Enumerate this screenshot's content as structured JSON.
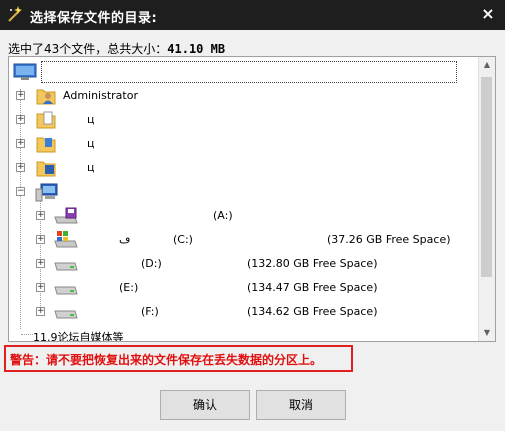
{
  "titlebar": {
    "title": "选择保存文件的目录:",
    "close": "×"
  },
  "summary": {
    "prefix": "选中了43个文件，总共大小：",
    "size": "41.10 MB"
  },
  "tree": {
    "root_label": "",
    "items": [
      {
        "label": "Administrator",
        "icon": "user-folder-icon"
      },
      {
        "label": "ц",
        "icon": "documents-folder-icon"
      },
      {
        "label": "ц",
        "icon": "music-folder-icon"
      },
      {
        "label": "ц",
        "icon": "games-folder-icon"
      },
      {
        "label": "",
        "icon": "computer-icon"
      }
    ],
    "drives": [
      {
        "name": "(A:)",
        "space": "",
        "icon": "floppy-drive-icon"
      },
      {
        "name": "(C:)",
        "prefix": "ڡ",
        "space": "(37.26 GB Free Space)",
        "icon": "system-drive-icon"
      },
      {
        "name": "(D:)",
        "space": "(132.80 GB Free Space)",
        "icon": "hard-drive-icon"
      },
      {
        "name": "(E:)",
        "space": "(134.47 GB Free Space)",
        "icon": "hard-drive-icon"
      },
      {
        "name": "(F:)",
        "space": "(134.62 GB Free Space)",
        "icon": "hard-drive-icon"
      }
    ],
    "last_item": "11.9论坛自媒体等"
  },
  "warning": "警告：请不要把恢复出来的文件保存在丢失数据的分区上。",
  "buttons": {
    "ok": "确认",
    "cancel": "取消"
  }
}
